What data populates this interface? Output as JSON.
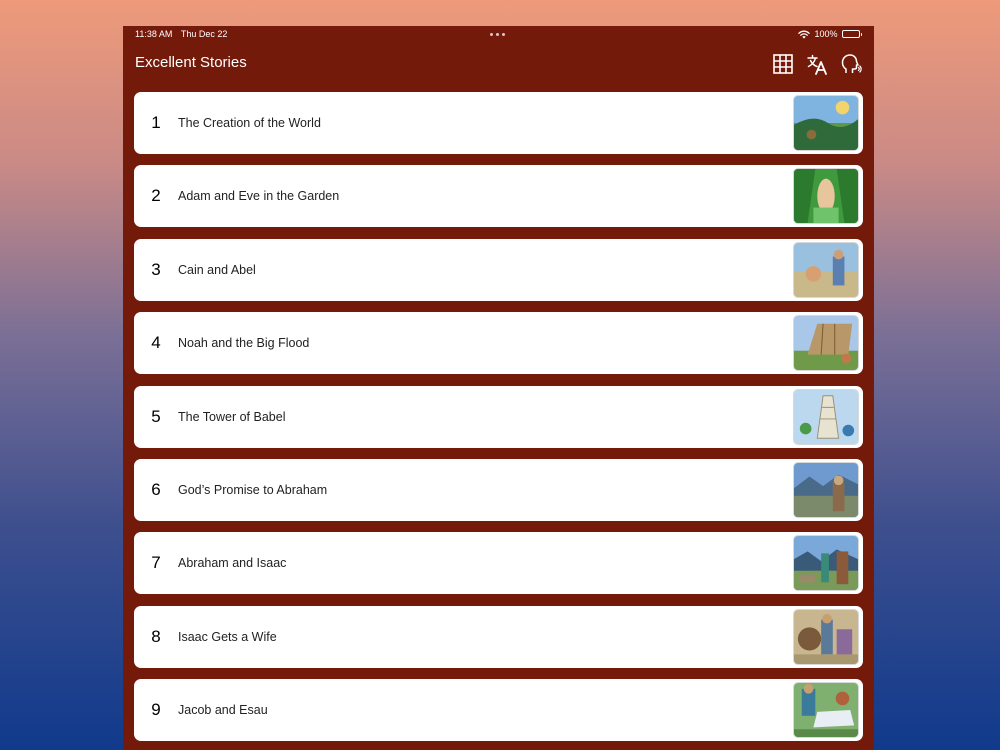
{
  "status_bar": {
    "time": "11:38 AM",
    "date": "Thu Dec 22",
    "battery": "100%"
  },
  "nav": {
    "title": "Excellent Stories",
    "actions": [
      {
        "name": "grid-view-button",
        "icon": "grid-icon"
      },
      {
        "name": "language-button",
        "icon": "translate-icon"
      },
      {
        "name": "audio-button",
        "icon": "listen-head-icon"
      }
    ]
  },
  "stories": [
    {
      "number": "1",
      "title": "The Creation of the World"
    },
    {
      "number": "2",
      "title": "Adam and Eve in the Garden"
    },
    {
      "number": "3",
      "title": "Cain and Abel"
    },
    {
      "number": "4",
      "title": "Noah and the Big Flood"
    },
    {
      "number": "5",
      "title": "The Tower of Babel"
    },
    {
      "number": "6",
      "title": "God’s Promise to Abraham"
    },
    {
      "number": "7",
      "title": "Abraham and Isaac"
    },
    {
      "number": "8",
      "title": "Isaac Gets a Wife"
    },
    {
      "number": "9",
      "title": "Jacob and Esau"
    }
  ],
  "colors": {
    "app_background": "#741a0b",
    "row_background": "#ffffff",
    "text": "#222222"
  }
}
